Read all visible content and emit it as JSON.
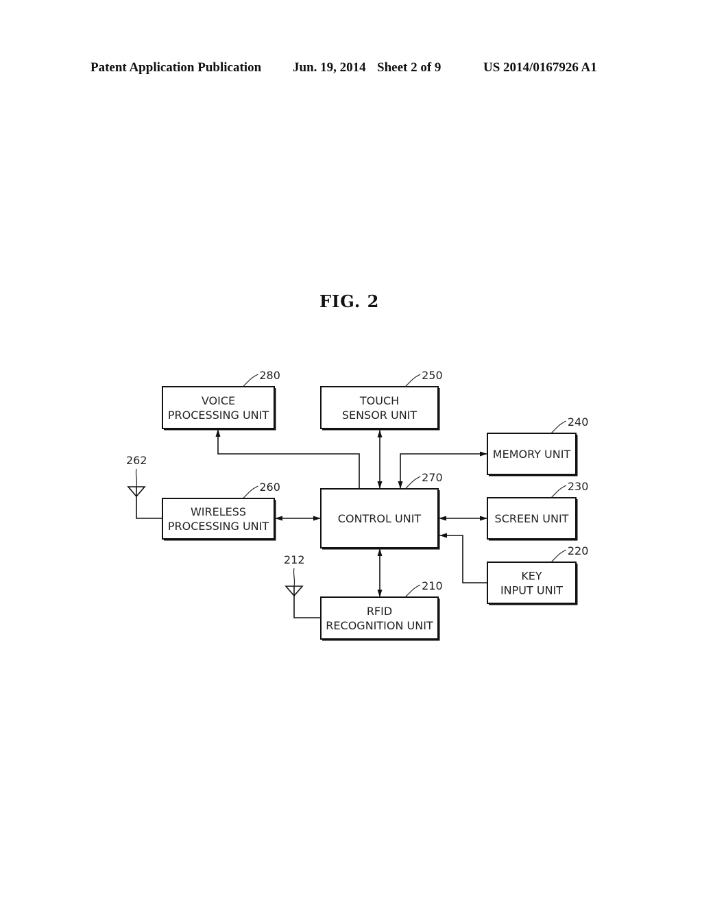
{
  "header": {
    "publication_type": "Patent Application Publication",
    "date": "Jun. 19, 2014",
    "sheet": "Sheet 2 of 9",
    "publication_number": "US 2014/0167926 A1"
  },
  "figure": {
    "title": "FIG.  2"
  },
  "blocks": [
    {
      "id": "voice",
      "ref": "280",
      "lines": [
        "VOICE",
        "PROCESSING UNIT"
      ]
    },
    {
      "id": "touch",
      "ref": "250",
      "lines": [
        "TOUCH",
        "SENSOR UNIT"
      ]
    },
    {
      "id": "memory",
      "ref": "240",
      "lines": [
        "MEMORY UNIT"
      ]
    },
    {
      "id": "wireless",
      "ref": "260",
      "lines": [
        "WIRELESS",
        "PROCESSING UNIT"
      ]
    },
    {
      "id": "control",
      "ref": "270",
      "lines": [
        "CONTROL UNIT"
      ]
    },
    {
      "id": "screen",
      "ref": "230",
      "lines": [
        "SCREEN UNIT"
      ]
    },
    {
      "id": "key",
      "ref": "220",
      "lines": [
        "KEY",
        "INPUT UNIT"
      ]
    },
    {
      "id": "rfid",
      "ref": "210",
      "lines": [
        "RFID",
        "RECOGNITION UNIT"
      ]
    }
  ],
  "antennas": [
    {
      "id": "wireless-antenna",
      "ref": "262",
      "connects_to": "wireless"
    },
    {
      "id": "rfid-antenna",
      "ref": "212",
      "connects_to": "rfid"
    }
  ],
  "connections": [
    {
      "from": "control",
      "to": "voice",
      "direction": "to"
    },
    {
      "from": "control",
      "to": "touch",
      "direction": "bidirectional"
    },
    {
      "from": "memory",
      "to": "control",
      "direction": "bidirectional"
    },
    {
      "from": "control",
      "to": "wireless",
      "direction": "bidirectional"
    },
    {
      "from": "control",
      "to": "screen",
      "direction": "bidirectional"
    },
    {
      "from": "key",
      "to": "control",
      "direction": "to"
    },
    {
      "from": "control",
      "to": "rfid",
      "direction": "bidirectional"
    }
  ]
}
